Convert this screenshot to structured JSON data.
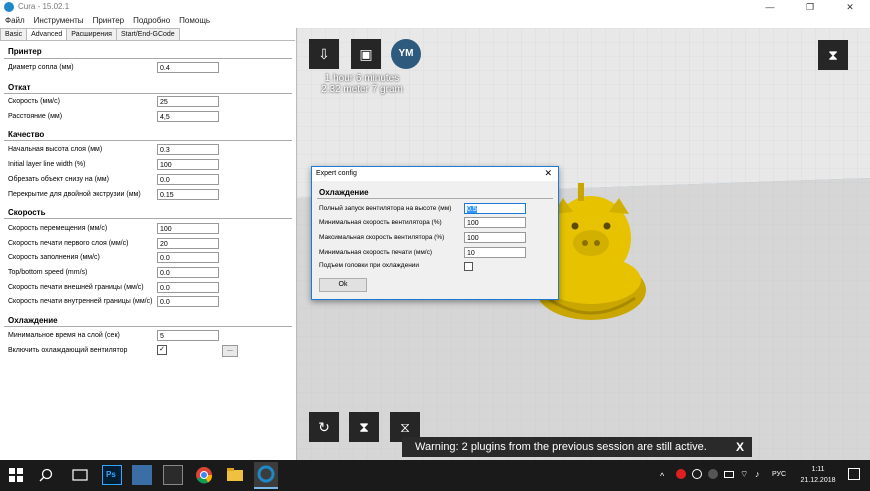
{
  "window": {
    "title": "Cura - 15.02.1",
    "controls": [
      "—",
      "❐",
      "✕"
    ]
  },
  "menu": [
    "Файл",
    "Инструменты",
    "Принтер",
    "Подробно",
    "Помощь"
  ],
  "tabs": [
    "Basic",
    "Advanced",
    "Расширения",
    "Start/End-GCode"
  ],
  "sections": {
    "printer": {
      "title": "Принтер",
      "nozzle_label": "Диаметр сопла (мм)",
      "nozzle_value": "0.4"
    },
    "retraction": {
      "title": "Откат",
      "speed_label": "Скорость (мм/с)",
      "speed_value": "25",
      "distance_label": "Расстояние (мм)",
      "distance_value": "4,5"
    },
    "quality": {
      "title": "Качество",
      "items": [
        {
          "label": "Начальная высота слоя (мм)",
          "value": "0.3"
        },
        {
          "label": "Initial layer line width (%)",
          "value": "100"
        },
        {
          "label": "Обрезать объект снизу на (мм)",
          "value": "0.0"
        },
        {
          "label": "Перекрытие для двойной экструзии (мм)",
          "value": "0.15"
        }
      ]
    },
    "speed": {
      "title": "Скорость",
      "items": [
        {
          "label": "Скорость перемещения (мм/с)",
          "value": "100"
        },
        {
          "label": "Скорость печати первого слоя (мм/с)",
          "value": "20"
        },
        {
          "label": "Скорость заполнения (мм/с)",
          "value": "0.0"
        },
        {
          "label": "Top/bottom speed (mm/s)",
          "value": "0.0"
        },
        {
          "label": "Скорость печати внешней границы (мм/с)",
          "value": "0.0"
        },
        {
          "label": "Скорость печати внутренней границы (мм/с)",
          "value": "0.0"
        }
      ]
    },
    "cooling": {
      "title": "Охлаждение",
      "min_time_label": "Минимальное время на слой (сек)",
      "min_time_value": "5",
      "fan_label": "Включить охлаждающий вентилятор",
      "fan_checked": "✓",
      "more_label": "..."
    }
  },
  "viewport": {
    "ym_label": "YM",
    "time": "1 hour 6 minutes",
    "material": "2.32 meter 7 gram",
    "warning": "Warning: 2 plugins from the previous session are still active.",
    "warning_close": "X"
  },
  "dialog": {
    "title": "Expert config",
    "close": "✕",
    "section": "Охлаждение",
    "fields": [
      {
        "label": "Полный запуск вентилятора на высоте (мм)",
        "value": "0.5"
      },
      {
        "label": "Минимальная скорость вентилятора (%)",
        "value": "100"
      },
      {
        "label": "Максимальная скорость вентилятора (%)",
        "value": "100"
      },
      {
        "label": "Минимальная скорость печати (мм/с)",
        "value": "10"
      }
    ],
    "lift_label": "Подъем головки при охлаждении",
    "ok": "Ok"
  },
  "taskbar": {
    "lang": "РУС",
    "time": "1:11",
    "date": "21.12.2018",
    "ps_label": "Ps"
  },
  "colors": {
    "viewport_bg": "#7ab6e8",
    "model": "#e6c200",
    "accent": "#1c79d5"
  }
}
